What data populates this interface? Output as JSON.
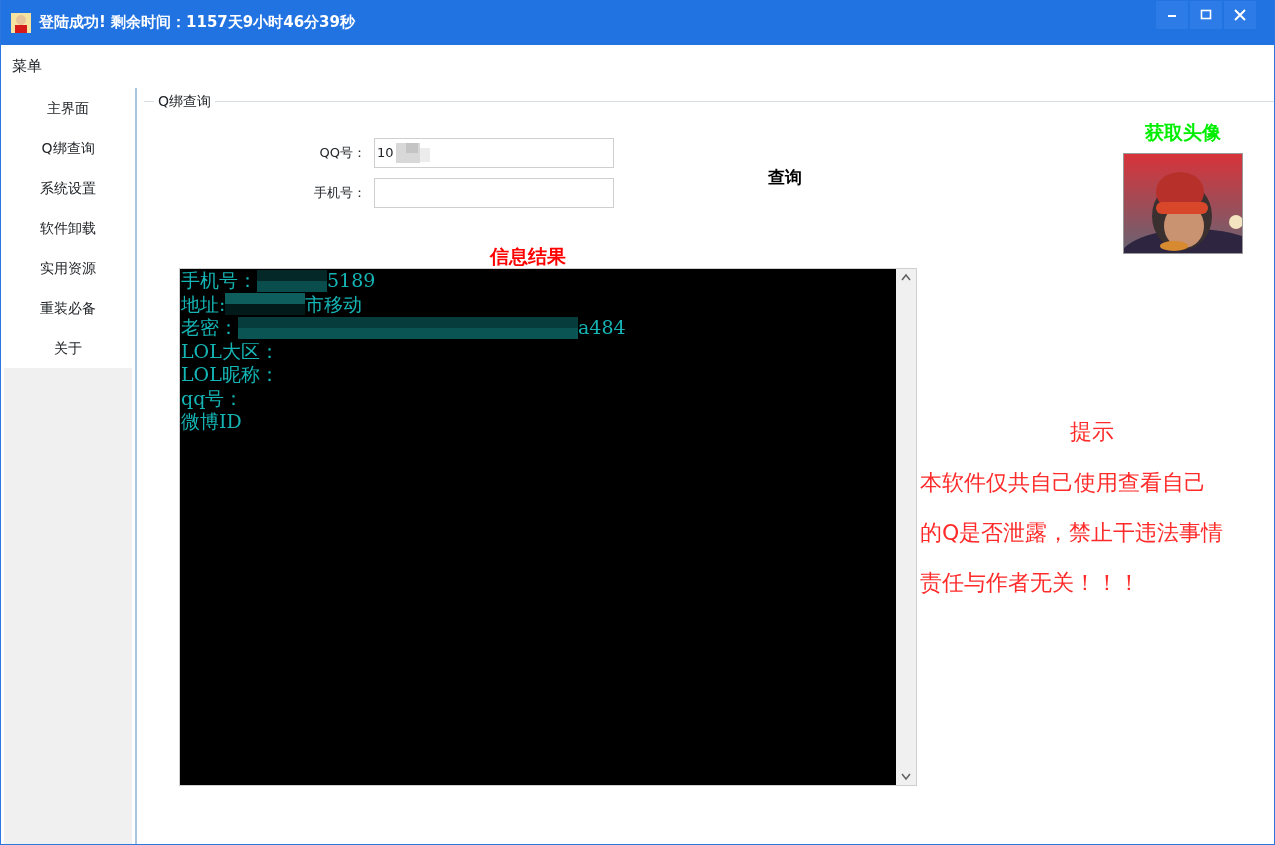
{
  "window": {
    "title": "登陆成功! 剩余时间：1157天9小时46分39秒"
  },
  "menu_bar": {
    "label": "菜单"
  },
  "sidebar": {
    "items": [
      {
        "label": "主界面",
        "selected": false
      },
      {
        "label": "Q绑查询",
        "selected": false
      },
      {
        "label": "系统设置",
        "selected": false
      },
      {
        "label": "软件卸载",
        "selected": false
      },
      {
        "label": "实用资源",
        "selected": false
      },
      {
        "label": "重装必备",
        "selected": false
      },
      {
        "label": "关于",
        "selected": false
      }
    ]
  },
  "group": {
    "title": "Q绑查询"
  },
  "form": {
    "fields": [
      {
        "label": "QQ号：",
        "value": "10",
        "redacted": true
      },
      {
        "label": "手机号：",
        "redacted": false
      }
    ]
  },
  "query_button": {
    "label": "查询"
  },
  "avatar": {
    "label": "获取头像",
    "kind": "picture"
  },
  "results": {
    "title": "信息结果",
    "lines": [
      {
        "label": "手机号：",
        "redacted": true,
        "tail": "5189"
      },
      {
        "label": "地址:",
        "redacted": true,
        "tail": "市移动"
      },
      {
        "label": "老密：",
        "redacted": true,
        "tail": "a484"
      },
      {
        "label": "LOL大区：",
        "redacted": false
      },
      {
        "label": "LOL昵称：",
        "redacted": false
      },
      {
        "label": "qq号：",
        "redacted": false
      },
      {
        "label": "微博ID",
        "redacted": false
      }
    ]
  },
  "notice": {
    "title": "提示",
    "lines": [
      "本软件仅共自己使用查看自己",
      "的Q是否泄露，禁止干违法事情",
      "责任与作者无关！！！"
    ]
  }
}
